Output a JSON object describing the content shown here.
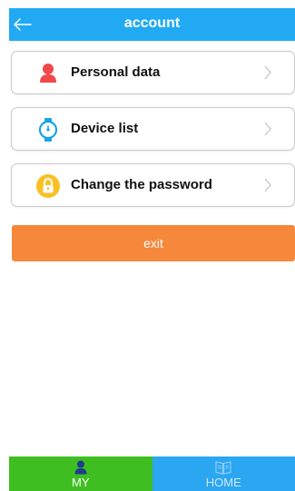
{
  "header": {
    "title": "account",
    "back_icon": "arrow-left-icon",
    "color": "#21aaf3"
  },
  "menu": [
    {
      "label": "Personal data",
      "icon": "person-icon",
      "icon_color": "#f04848"
    },
    {
      "label": "Device list",
      "icon": "watch-icon",
      "icon_color": "#1aa3e8"
    },
    {
      "label": "Change the password",
      "icon": "lock-icon",
      "icon_color": "#f7c125"
    }
  ],
  "exit": {
    "label": "exit",
    "color": "#f5883b"
  },
  "tabbar": [
    {
      "label": "MY",
      "icon": "person-icon",
      "active": true,
      "color": "#3fbe21"
    },
    {
      "label": "HOME",
      "icon": "book-icon",
      "active": false,
      "color": "#2ba6f1"
    }
  ]
}
